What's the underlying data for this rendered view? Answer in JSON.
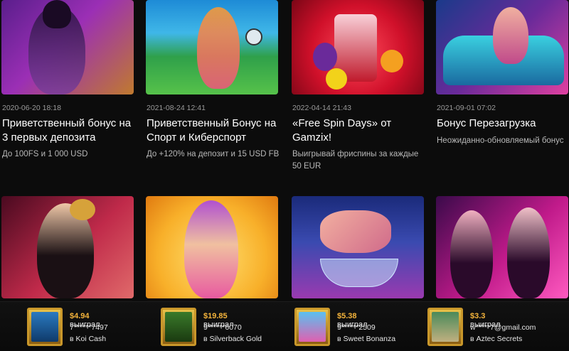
{
  "promos": [
    {
      "date": "2020-06-20 18:18",
      "title": "Приветственный бонус на 3 первых депозита",
      "desc": "До 100FS и 1 000 USD"
    },
    {
      "date": "2021-08-24 12:41",
      "title": "Приветственный Бонус на Спорт и Киберспорт",
      "desc": "До +120% на депозит и 15 USD FB"
    },
    {
      "date": "2022-04-14 21:43",
      "title": "«Free Spin Days» от Gamzix!",
      "desc": "Выигрывай фриспины за каждые 50 EUR"
    },
    {
      "date": "2021-09-01 07:02",
      "title": "Бонус Перезагрузка",
      "desc": "Неожиданно-обновляемый бонус"
    }
  ],
  "wins": [
    {
      "amount": "$4.94",
      "word": "выиграл",
      "user": "7******7497",
      "game": "в Koi Cash"
    },
    {
      "amount": "$19.85",
      "word": "выиграл",
      "user": "9******6070",
      "game": "в Silverback Gold"
    },
    {
      "amount": "$5.38",
      "word": "выиграл",
      "user": "9******2509",
      "game": "в Sweet Bonanza"
    },
    {
      "amount": "$3.3",
      "word": "выиграл",
      "user": "w*****7@gmail.com",
      "game": "в Aztec Secrets"
    }
  ],
  "colors": {
    "accent": "#f5b43b",
    "background": "#0c0c0c",
    "frame_gold": "#c9972a"
  }
}
